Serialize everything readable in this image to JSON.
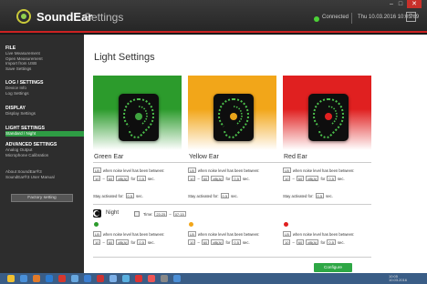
{
  "window": {
    "brand": "SoundEar",
    "title": "Settings",
    "status": "Connected",
    "datetime": "Thu 10.03.2016 10:05:69",
    "help": "?",
    "min": "–",
    "max": "□",
    "close": "✕"
  },
  "sidebar": {
    "sections": [
      {
        "title": "FILE",
        "items": [
          "Live Measurement",
          "Open Measurement",
          "Import from USB",
          "Save Settings"
        ]
      },
      {
        "title": "LOG / SETTINGS",
        "items": [
          "Device Info",
          "Log Settings"
        ]
      },
      {
        "title": "DISPLAY",
        "items": [
          "Display Settings"
        ]
      },
      {
        "title": "LIGHT SETTINGS",
        "items": [
          "Standard / Night"
        ]
      },
      {
        "title": "ADVANCED SETTINGS",
        "items": [
          "Analog Output",
          "Microphone Calibration"
        ]
      },
      {
        "title": "",
        "items": [
          "About SoundEar®3",
          "SoundEar®3 User Manual"
        ]
      }
    ],
    "active_item": "Standard / Night",
    "factory_button": "Factory setting"
  },
  "main": {
    "title": "Light Settings",
    "panels": [
      {
        "name": "Green Ear",
        "color": "#2c9b2c",
        "ring": "#4cc04c",
        "center": "#3fa33f"
      },
      {
        "name": "Yellow Ear",
        "color": "#f2a619",
        "ring": "#4cc04c",
        "center": "#e9a41a"
      },
      {
        "name": "Red Ear",
        "color": "#e02020",
        "ring": "#4cc04c",
        "center": "#e02020"
      }
    ],
    "controls": {
      "dropdown": "LB",
      "when_label": "when noise level has been between:",
      "low_value": "10",
      "dash": "–",
      "high_value": "60",
      "unit": "dB(A)",
      "for_label": "for",
      "for_value": "0,5",
      "sec": "sec.",
      "stay_label": "Stay activated for:",
      "stay_value": "0,5",
      "stay_sec": "sec."
    },
    "night": {
      "label": "Night",
      "time_label": "Time:",
      "time_from": "23:25",
      "time_to": "07:15"
    },
    "configure_button": "Configure"
  },
  "taskbar": {
    "icon_colors": [
      "#f0c030",
      "#4a90d9",
      "#e07a2a",
      "#2b7bd1",
      "#d7372d",
      "#68a8e0",
      "#3b7fd2",
      "#c33",
      "#7db0e8",
      "#5ab0e0",
      "#d33",
      "#e55",
      "#888",
      "#4c8fd6"
    ],
    "tray_time": "10:05",
    "tray_date": "10.03.2016"
  }
}
